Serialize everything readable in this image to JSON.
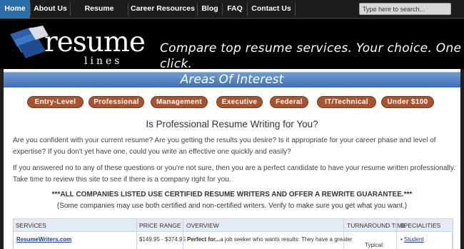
{
  "nav": {
    "items": [
      {
        "label": "Home",
        "active": true
      },
      {
        "label": "About Us"
      },
      {
        "label": "Resume Samples"
      },
      {
        "label": "Career Resources"
      },
      {
        "label": "Blog"
      },
      {
        "label": "FAQ"
      },
      {
        "label": "Contact Us"
      }
    ],
    "search_placeholder": "Type here to search..."
  },
  "header": {
    "logo_main": "resume",
    "logo_sub": "lines",
    "tagline": "Compare top resume services. Your choice. One click."
  },
  "areas": {
    "title": "Areas Of Interest",
    "categories": [
      "Entry-Level",
      "Professional",
      "Management",
      "Executive",
      "Federal",
      "IT/Technical",
      "Under $100"
    ]
  },
  "content": {
    "heading": "Is Professional Resume Writing for You?",
    "para1": "Are you confident with your current resume? Are you getting the results you desire? Is it appropriate for your career phase and level of expertise? If you don't yet have one, could you write an effective one quickly and easily?",
    "para2": "If you answered no to any of these questions or you're not sure, then you are a perfect candidate to have your resume written professionally. Take time to review this site to see if there is a company right for you.",
    "notice": "***ALL COMPANIES LISTED USE CERTIFIED RESUME WRITERS AND OFFER A REWRITE GUARANTEE.***",
    "notice_sub": "(Some companies may use both certified and non-certified writers. Verify to make sure you get what you want.)"
  },
  "table": {
    "headers": [
      "SERVICES",
      "PRICE RANGE",
      "OVERVIEW",
      "TURNAROUND TIME",
      "SPECIALITIES"
    ],
    "rows": [
      {
        "service": "ResumeWriters.com",
        "price": "$149.95 - $374.95",
        "overview_bold": "Perfect for...",
        "overview_rest": "a job seeker who wants results: They have a greater",
        "turnaround": "Typical:",
        "speciality": "Student"
      }
    ]
  },
  "colors": {
    "nav_bg": "#1c1c1c",
    "nav_active": "#2d6faa",
    "header_bg": "#000000",
    "aoi_bar": "#4f80bf",
    "category_button": "#a8532f",
    "table_header_bg": "#e3ecf4",
    "link": "#1a3f8b"
  }
}
